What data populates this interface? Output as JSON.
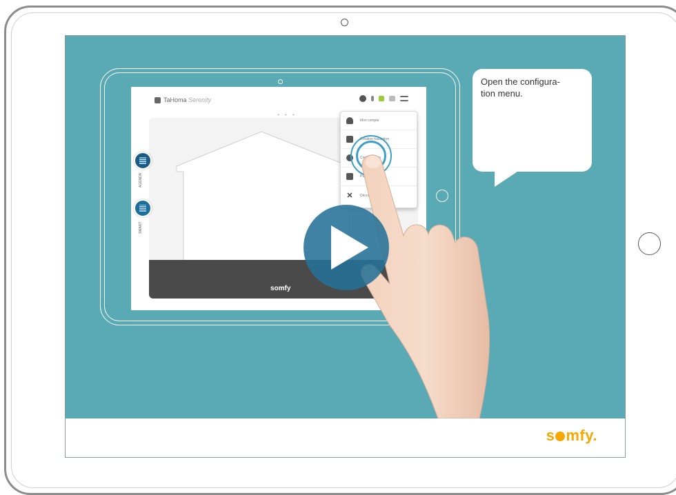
{
  "bubble": {
    "text": "Open the configura-\ntion menu."
  },
  "brand": {
    "logo_pre": "s",
    "logo_post": "mfy",
    "logo_dot": "."
  },
  "inner_app": {
    "logo_main": "TaHoma",
    "logo_sub": "Serenity",
    "footer_logo": "somfy",
    "side_labels": [
      "AGENDA",
      "SMART"
    ],
    "page_dots": "• • •"
  },
  "config_menu": {
    "items": [
      {
        "icon": "user-icon",
        "label": "Mon compte"
      },
      {
        "icon": "house-edit-icon",
        "label": "Création habitation"
      },
      {
        "icon": "gear-icon",
        "label": "Configuration"
      },
      {
        "icon": "wrench-icon",
        "label": "Paramètres"
      },
      {
        "icon": "close-icon",
        "label": "Déconnexion"
      }
    ]
  },
  "colors": {
    "teal": "#59aab4",
    "somfy_yellow": "#f5a800",
    "play_blue": "#257196",
    "app_footer": "#4a4a4a"
  }
}
